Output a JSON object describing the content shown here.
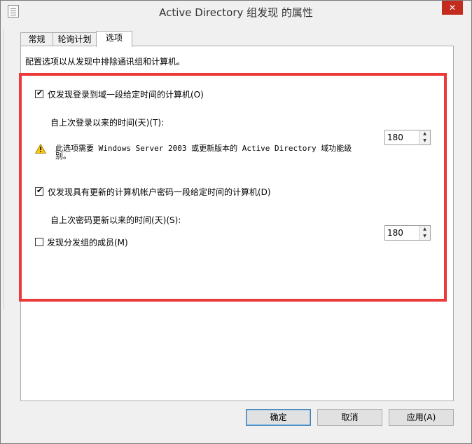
{
  "window": {
    "title": "Active Directory 组发现 的属性",
    "close_icon": "close-icon"
  },
  "tabs": [
    {
      "label": "常规",
      "active": false
    },
    {
      "label": "轮询计划",
      "active": false
    },
    {
      "label": "选项",
      "active": true
    }
  ],
  "panel": {
    "intro": "配置选项以从发现中排除通讯组和计算机。",
    "option1": {
      "checked": true,
      "label": "仅发现登录到域一段给定时间的计算机(O)",
      "sub_label": "自上次登录以来的时间(天)(T):",
      "value": "180"
    },
    "warning": {
      "icon": "warning-icon",
      "text": "此选项需要 Windows Server 2003 或更新版本的 Active Directory 域功能级别。"
    },
    "option2": {
      "checked": true,
      "label": "仅发现具有更新的计算机帐户密码一段给定时间的计算机(D)",
      "sub_label": "自上次密码更新以来的时间(天)(S):",
      "value": "180"
    },
    "option3": {
      "checked": false,
      "label": "发现分发组的成员(M)"
    },
    "highlight_color": "#ea3a3a"
  },
  "buttons": {
    "ok": "确定",
    "cancel": "取消",
    "apply": "应用(A)"
  }
}
